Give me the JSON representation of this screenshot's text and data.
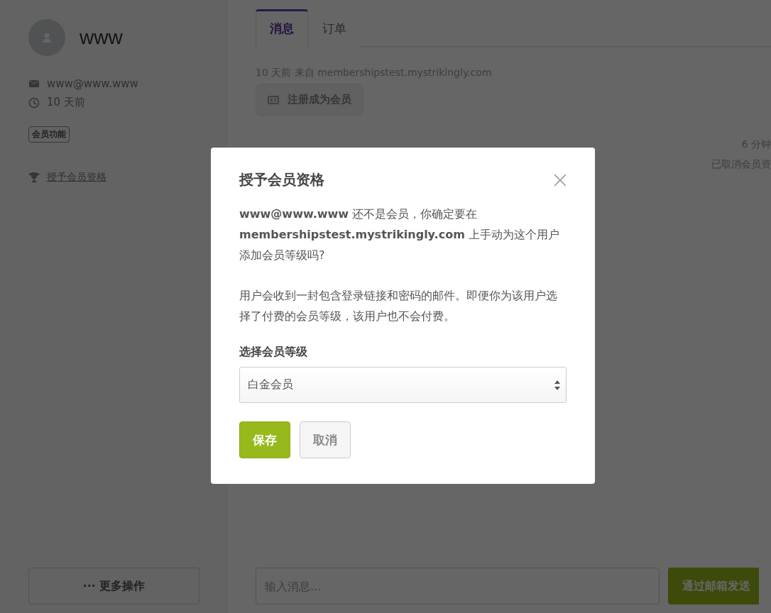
{
  "sidebar": {
    "name": "www",
    "email": "www@www.www",
    "joined": "10 天前",
    "tag": "会员功能",
    "grant_link": "授予会员资格",
    "more_button": "··· 更多操作"
  },
  "tabs": [
    {
      "label": "消息",
      "selected": true
    },
    {
      "label": "订单",
      "selected": false
    }
  ],
  "feed": {
    "meta": "10 天前 来自 membershipstest.mystrikingly.com",
    "event": "注册成为会员",
    "activity_time": "6 分钟",
    "activity_text": "已取消会员资"
  },
  "compose": {
    "placeholder": "输入消息...",
    "send_button": "通过邮箱发送"
  },
  "dialog": {
    "title": "授予会员资格",
    "paragraphs": [
      "**www@www.www** 还不是会员，你确定要在 **membershipstest.mystrikingly.com** 上手动为这个用户添加会员等级吗?",
      "用户会收到一封包含登录链接和密码的邮件。即便你为该用户选择了付费的会员等级，该用户也不会付费。"
    ],
    "select_label": "选择会员等级",
    "select_value": "白金会员",
    "save_button": "保存",
    "cancel_button": "取消"
  }
}
